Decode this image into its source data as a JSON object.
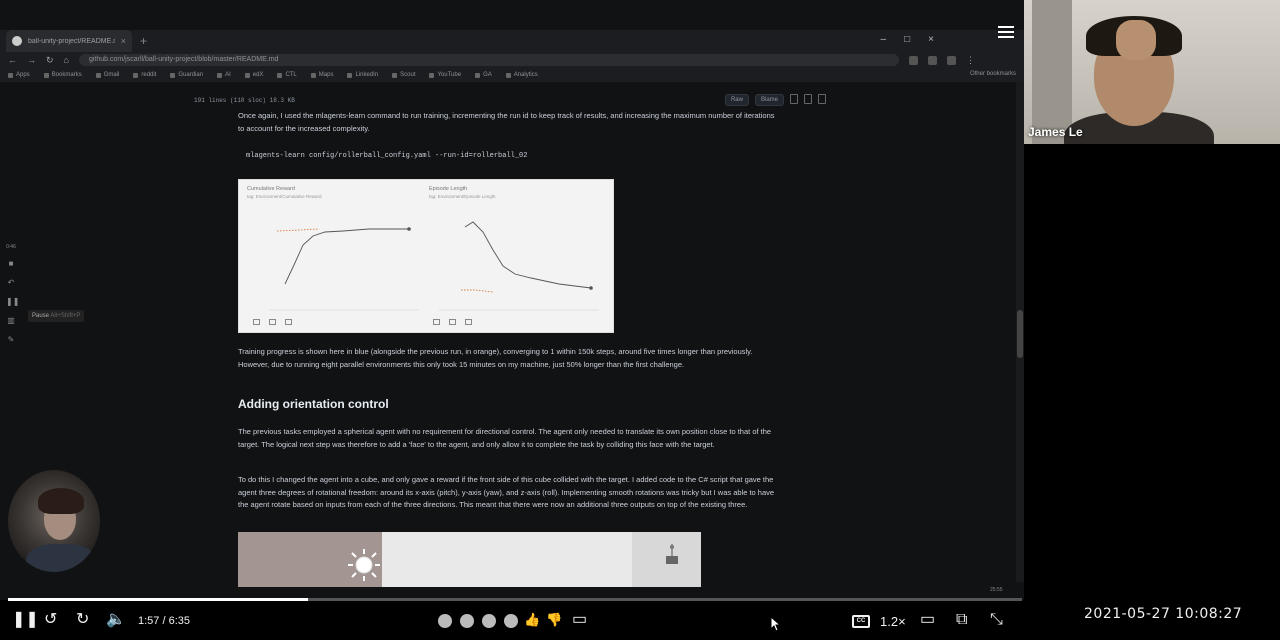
{
  "browser": {
    "tab_title": "ball-unity-project/README.md",
    "url": "github.com/jscarll/ball-unity-project/blob/master/README.md",
    "bookmarks": [
      "Apps",
      "Bookmarks",
      "Gmail",
      "reddit",
      "Guardian",
      "AI",
      "edX",
      "CTL",
      "Maps",
      "LinkedIn",
      "Scout",
      "YouTube",
      "GA",
      "Analytics"
    ],
    "other_bookmarks": "Other bookmarks"
  },
  "file": {
    "info": "191 lines (110 sloc)  18.3 KB",
    "raw_label": "Raw",
    "blame_label": "Blame"
  },
  "content": {
    "para1": "Once again, I used the mlagents-learn command to run training, incrementing the run id to keep track of results, and increasing the maximum number of iterations to account for the increased complexity.",
    "code": "mlagents-learn config/rollerball_config.yaml --run-id=rollerball_02",
    "para2": "Training progress is shown here in blue (alongside the previous run, in orange), converging to 1 within 150k steps, around five times longer than previously. However, due to running eight parallel environments this only took 15 minutes on my machine, just 50% longer than the first challenge.",
    "heading": "Adding orientation control",
    "para3": "The previous tasks employed a spherical agent with no requirement for directional control. The agent only needed to translate its own position close to that of the target. The logical next step was therefore to add a 'face' to the agent, and only allow it to complete the task by colliding this face with the target.",
    "para4": "To do this I changed the agent into a cube, and only gave a reward if the front side of this cube collided with the target. I added code to the C# script that gave the agent three degrees of rotational freedom: around its x-axis (pitch), y-axis (yaw), and z-axis (roll). Implementing smooth rotations was tricky but I was able to have the agent rotate based on inputs from each of the three directions. This meant that there were now an additional three outputs on top of the existing three."
  },
  "figure": {
    "left_title": "Cumulative Reward",
    "left_sub": "tag: Environment/Cumulative Reward",
    "right_title": "Episode Length",
    "right_sub": "tag: Environment/Episode Length"
  },
  "annotation": {
    "timer": "0:46",
    "tooltip_label": "Pause",
    "tooltip_shortcut": "Alt+Shift+P"
  },
  "player": {
    "current_time": "1:57",
    "duration": "6:35",
    "time_display": "1:57 / 6:35",
    "progress": 0.296,
    "speed": "1.2×",
    "cc": "CC"
  },
  "scroll_time": "25:55",
  "call": {
    "name": "James Le"
  },
  "timestamp": "2021-05-27  10:08:27",
  "colors": {
    "page_bg": "#111214",
    "text": "#c9d1d9",
    "accent": "#ffffff"
  }
}
